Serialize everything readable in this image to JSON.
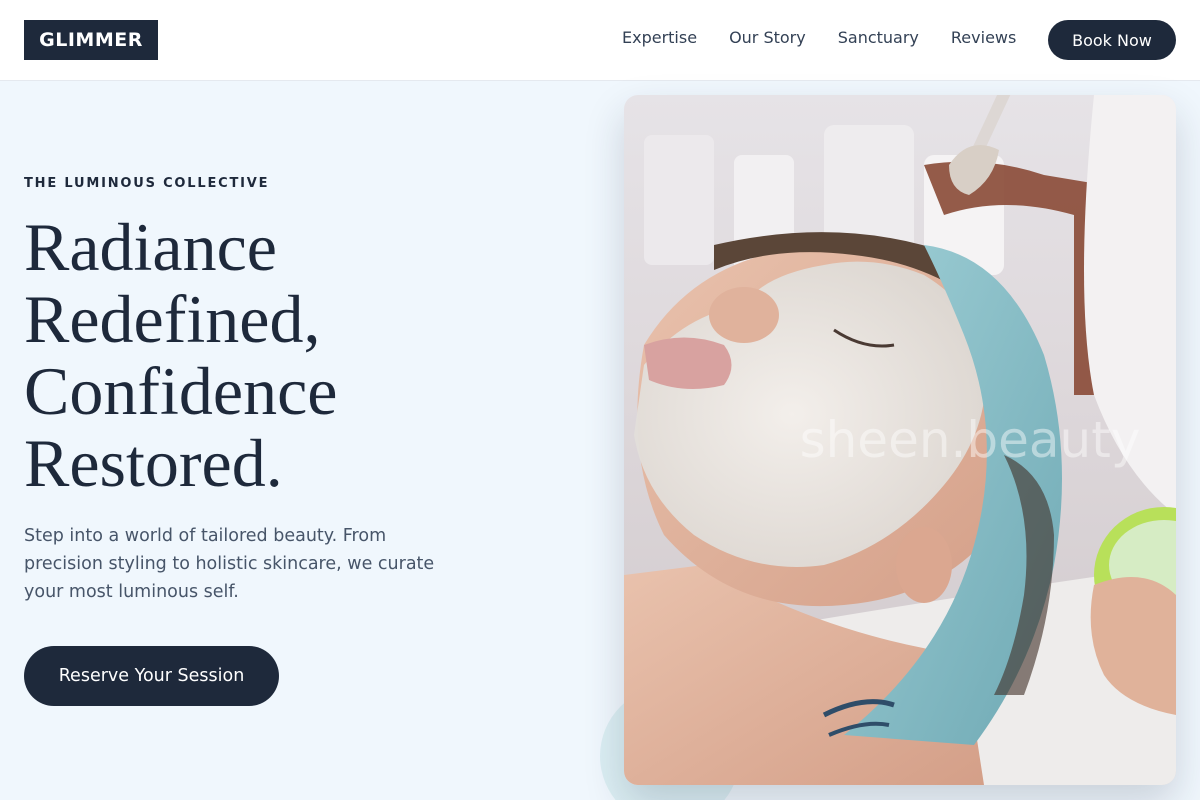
{
  "header": {
    "logo": "GLIMMER",
    "nav": [
      "Expertise",
      "Our Story",
      "Sanctuary",
      "Reviews"
    ],
    "book_label": "Book Now"
  },
  "hero": {
    "eyebrow": "THE LUMINOUS COLLECTIVE",
    "headline": [
      "Radiance",
      "Redefined,",
      "Confidence",
      "Restored."
    ],
    "lede": "Step into a world of tailored beauty. From precision styling to holistic skincare, we curate your most luminous self.",
    "cta_label": "Reserve Your Session",
    "image": {
      "subject": "woman receiving facial mask treatment with brush",
      "watermark": "sheen.beauty"
    }
  },
  "colors": {
    "primary": "#1e293b",
    "page_bg": "#f0f7fd",
    "body_text": "#475569",
    "accent_circle": "#dbeef3"
  }
}
